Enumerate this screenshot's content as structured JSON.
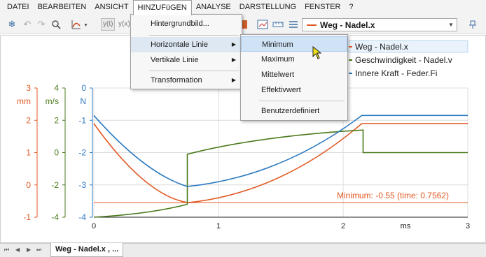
{
  "menubar": {
    "items": [
      "DATEI",
      "BEARBEITEN",
      "ANSICHT",
      "HINZUFüGEN",
      "ANALYSE",
      "DARSTELLUNG",
      "FENSTER",
      "?"
    ],
    "active_index": 3
  },
  "toolbar": {
    "icons": [
      "snowflake-icon",
      "undo-icon",
      "redo-icon",
      "zoom-icon",
      "curve-icon",
      "y-of-t-icon",
      "y-of-x-icon",
      "color-icon",
      "table-icon",
      "ruler-icon",
      "list-icon"
    ],
    "y_of_t_label": "y(t)",
    "y_of_x_label": "y(x)",
    "signal_select_value": "Weg - Nadel.x"
  },
  "menu": {
    "items": [
      "Hintergrundbild...",
      "Horizontale Linie",
      "Vertikale Linie",
      "Transformation"
    ],
    "highlighted": "Horizontale Linie"
  },
  "submenu": {
    "items": [
      "Minimum",
      "Maximum",
      "Mittelwert",
      "Effektivwert",
      "Benutzerdefiniert"
    ],
    "highlighted": "Minimum"
  },
  "legend": {
    "entries": [
      "Weg - Nadel.x",
      "Geschwindigkeit - Nadel.v",
      "Innere Kraft - Feder.Fi"
    ]
  },
  "chart_data": {
    "type": "line",
    "x": [
      0,
      0.75,
      0.7562,
      2.15,
      2.16,
      3
    ],
    "xlabel": "ms",
    "xlim": [
      0,
      3
    ],
    "x_ticks": [
      "0",
      "1",
      "2",
      "3"
    ],
    "series": [
      {
        "name": "Weg - Nadel.x",
        "unit": "mm",
        "color": "#e25a24",
        "ylim": [
          -1,
          3
        ],
        "y_ticks": [
          "3",
          "2",
          "1",
          "0",
          "-1"
        ],
        "points": [
          [
            0,
            1.9
          ],
          [
            0.7562,
            -0.55
          ],
          [
            2.15,
            1.9
          ],
          [
            3,
            1.9
          ]
        ]
      },
      {
        "name": "Geschwindigkeit - Nadel.v",
        "unit": "m/s",
        "color": "#4a7a1a",
        "ylim": [
          -4,
          4
        ],
        "y_ticks": [
          "4",
          "2",
          "0",
          "-2",
          "-4"
        ],
        "points": [
          [
            0,
            -4
          ],
          [
            0.75,
            -3.2
          ],
          [
            0.75,
            -0.1
          ],
          [
            2.16,
            1.4
          ],
          [
            2.16,
            0
          ],
          [
            3,
            0
          ]
        ]
      },
      {
        "name": "Innere Kraft - Feder.Fi",
        "unit": "N",
        "color": "#2a78c0",
        "ylim": [
          -4,
          0
        ],
        "y_ticks": [
          "0",
          "-1",
          "-2",
          "-3",
          "-4"
        ],
        "points": [
          [
            0,
            -0.85
          ],
          [
            0.75,
            -3.05
          ],
          [
            2.15,
            -0.85
          ],
          [
            3,
            -0.85
          ]
        ]
      }
    ],
    "annotation": "Minimum: -0.55 (time: 0.7562)",
    "annotation_value": -0.55,
    "grid": true
  },
  "tabs": {
    "document_tab": "Weg - Nadel.x , ..."
  }
}
